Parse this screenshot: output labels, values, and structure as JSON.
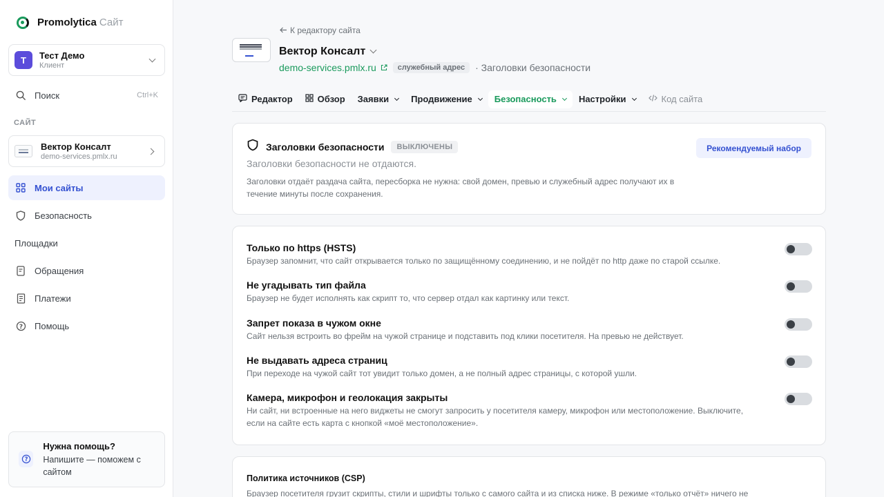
{
  "brand": {
    "name": "Promolytica",
    "sub": "Сайт"
  },
  "account": {
    "initial": "Т",
    "name": "Тест Демо",
    "role": "Клиент"
  },
  "search": {
    "label": "Поиск",
    "shortcut": "Ctrl+K"
  },
  "section_label": "САЙТ",
  "site_card": {
    "name": "Вектор Консалт",
    "url": "demo-services.pmlx.ru"
  },
  "nav": {
    "my_sites": "Мои сайты",
    "security": "Безопасность",
    "platforms": "Площадки",
    "requests": "Обращения",
    "payments": "Платежи",
    "help": "Помощь"
  },
  "help_box": {
    "title": "Нужна помощь?",
    "desc": "Напишите — поможем с сайтом"
  },
  "header": {
    "back": "К редактору сайта",
    "title": "Вектор Консалт",
    "url": "demo-services.pmlx.ru",
    "badge": "служебный адрес",
    "crumb": "· Заголовки безопасности"
  },
  "tabs": {
    "editor": "Редактор",
    "overview": "Обзор",
    "requests": "Заявки",
    "promotion": "Продвижение",
    "security": "Безопасность",
    "settings": "Настройки",
    "code": "Код сайта"
  },
  "security_card": {
    "title": "Заголовки безопасности",
    "status": "ВЫКЛЮЧЕНЫ",
    "button": "Рекомендуемый набор",
    "subtitle": "Заголовки безопасности не отдаются.",
    "desc": "Заголовки отдаёт раздача сайта, пересборка не нужна: свой домен, превью и служебный адрес получают их в течение минуты после сохранения."
  },
  "options": [
    {
      "title": "Только по https (HSTS)",
      "desc": "Браузер запомнит, что сайт открывается только по защищённому соединению, и не пойдёт по http даже по старой ссылке.",
      "enabled": false
    },
    {
      "title": "Не угадывать тип файла",
      "desc": "Браузер не будет исполнять как скрипт то, что сервер отдал как картинку или текст.",
      "enabled": false
    },
    {
      "title": "Запрет показа в чужом окне",
      "desc": "Сайт нельзя встроить во фрейм на чужой странице и подставить под клики посетителя. На превью не действует.",
      "enabled": false
    },
    {
      "title": "Не выдавать адреса страниц",
      "desc": "При переходе на чужой сайт тот увидит только домен, а не полный адрес страницы, с которой ушли.",
      "enabled": false
    },
    {
      "title": "Камера, микрофон и геолокация закрыты",
      "desc": "Ни сайт, ни встроенные на него виджеты не смогут запросить у посетителя камеру, микрофон или местоположение. Выключите, если на сайте есть карта с кнопкой «моё местоположение».",
      "enabled": false
    }
  ],
  "csp_card": {
    "title": "Политика источников (CSP)",
    "desc": "Браузер посетителя грузит скрипты, стили и шрифты только с самого сайта и из списка ниже. В режиме «только отчёт» ничего не"
  },
  "colors": {
    "accent": "#3451d1",
    "green": "#1a9a5c",
    "avatar": "#5b4cdb"
  }
}
